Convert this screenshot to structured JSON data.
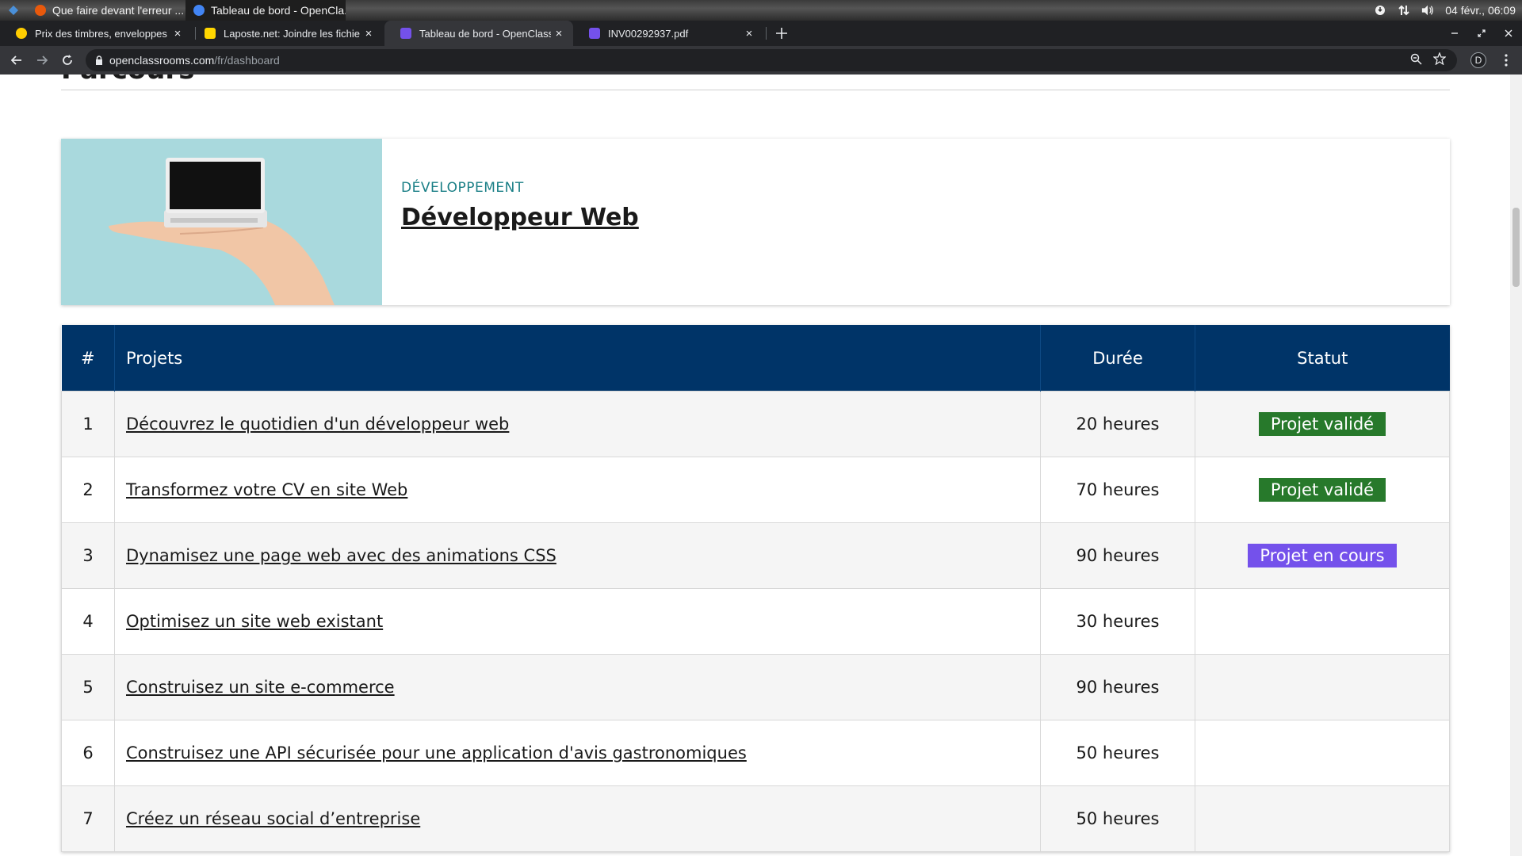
{
  "taskbar": {
    "windows": [
      {
        "title": "Que faire devant l'erreur ...",
        "color": "#e8590c"
      },
      {
        "title": "Tableau de bord - OpenCla...",
        "color": "#4285f4"
      }
    ],
    "clock": "04 févr., 06:09"
  },
  "tabs": [
    {
      "title": "Prix des timbres, enveloppes",
      "close": "×",
      "favicon_color": "#ffcd00"
    },
    {
      "title": "Laposte.net: Joindre les fichie",
      "close": "×",
      "favicon_color": "#ffd600"
    },
    {
      "title": "Tableau de bord - OpenClassr",
      "close": "×",
      "favicon_color": "#7451eb"
    },
    {
      "title": "INV00292937.pdf",
      "close": "×",
      "favicon_color": "#7451eb"
    }
  ],
  "address_bar": {
    "host": "openclassrooms.com",
    "path": "/fr/dashboard",
    "profile_initial": "D"
  },
  "page": {
    "heading": "Parcours",
    "course": {
      "category": "DÉVELOPPEMENT",
      "title": "Développeur Web"
    },
    "table": {
      "headers": {
        "num": "#",
        "name": "Projets",
        "duration": "Durée",
        "status": "Statut"
      },
      "rows": [
        {
          "num": "1",
          "name": "Découvrez le quotidien d'un développeur web",
          "duration": "20 heures",
          "status": "Projet validé",
          "status_color": "#27792b"
        },
        {
          "num": "2",
          "name": "Transformez votre CV en site Web",
          "duration": "70 heures",
          "status": "Projet validé",
          "status_color": "#27792b"
        },
        {
          "num": "3",
          "name": "Dynamisez une page web avec des animations CSS",
          "duration": "90 heures",
          "status": "Projet en cours",
          "status_color": "#7451eb"
        },
        {
          "num": "4",
          "name": "Optimisez un site web existant",
          "duration": "30 heures",
          "status": "",
          "status_color": ""
        },
        {
          "num": "5",
          "name": "Construisez un site e-commerce",
          "duration": "90 heures",
          "status": "",
          "status_color": ""
        },
        {
          "num": "6",
          "name": "Construisez une API sécurisée pour une application d'avis gastronomiques",
          "duration": "50 heures",
          "status": "",
          "status_color": ""
        },
        {
          "num": "7",
          "name": "Créez un réseau social d’entreprise",
          "duration": "50 heures",
          "status": "",
          "status_color": ""
        }
      ]
    }
  },
  "colors": {
    "table_header": "#003468",
    "category": "#1a7f86",
    "validated": "#27792b",
    "in_progress": "#7451eb"
  }
}
